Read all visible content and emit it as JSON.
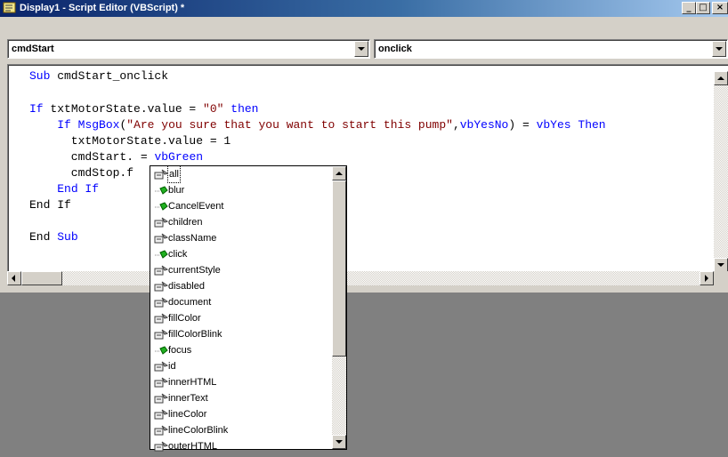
{
  "window": {
    "title": "Display1 - Script Editor (VBScript) *",
    "minimize_glyph": "_",
    "maximize_glyph": "□",
    "close_glyph": "×"
  },
  "combos": {
    "object": "cmdStart",
    "event": "onclick"
  },
  "code": {
    "lines": [
      [
        {
          "t": "Sub",
          "c": "kw"
        },
        {
          "t": " cmdStart_onclick",
          "c": ""
        }
      ],
      [],
      [
        {
          "t": "If",
          "c": "kw"
        },
        {
          "t": " txtMotorState.value = ",
          "c": ""
        },
        {
          "t": "\"0\"",
          "c": "str"
        },
        {
          "t": " ",
          "c": ""
        },
        {
          "t": "then",
          "c": "kw"
        }
      ],
      [
        {
          "t": "    ",
          "c": ""
        },
        {
          "t": "If",
          "c": "kw"
        },
        {
          "t": " ",
          "c": ""
        },
        {
          "t": "MsgBox",
          "c": "kw"
        },
        {
          "t": "(",
          "c": ""
        },
        {
          "t": "\"Are you sure that you want to start this pump\"",
          "c": "str"
        },
        {
          "t": ",",
          "c": ""
        },
        {
          "t": "vbYesNo",
          "c": "kw"
        },
        {
          "t": ") = ",
          "c": ""
        },
        {
          "t": "vbYes",
          "c": "kw"
        },
        {
          "t": " ",
          "c": ""
        },
        {
          "t": "Then",
          "c": "kw"
        }
      ],
      [
        {
          "t": "      txtMotorState.value = 1",
          "c": ""
        }
      ],
      [
        {
          "t": "      cmdStart. = ",
          "c": ""
        },
        {
          "t": "vbGreen",
          "c": "kw"
        }
      ],
      [
        {
          "t": "      cmdStop.f",
          "c": ""
        }
      ],
      [
        {
          "t": "    ",
          "c": ""
        },
        {
          "t": "End If",
          "c": "kw"
        }
      ],
      [
        {
          "t": "End If",
          "c": ""
        }
      ],
      [],
      [
        {
          "t": "End ",
          "c": ""
        },
        {
          "t": "Sub",
          "c": "kw"
        }
      ]
    ]
  },
  "autocomplete": {
    "selected": "all",
    "items": [
      {
        "label": "all",
        "kind": "property"
      },
      {
        "label": "blur",
        "kind": "method"
      },
      {
        "label": "CancelEvent",
        "kind": "method"
      },
      {
        "label": "children",
        "kind": "property"
      },
      {
        "label": "className",
        "kind": "property"
      },
      {
        "label": "click",
        "kind": "method"
      },
      {
        "label": "currentStyle",
        "kind": "property"
      },
      {
        "label": "disabled",
        "kind": "property"
      },
      {
        "label": "document",
        "kind": "property"
      },
      {
        "label": "fillColor",
        "kind": "property"
      },
      {
        "label": "fillColorBlink",
        "kind": "property"
      },
      {
        "label": "focus",
        "kind": "method"
      },
      {
        "label": "id",
        "kind": "property"
      },
      {
        "label": "innerHTML",
        "kind": "property"
      },
      {
        "label": "innerText",
        "kind": "property"
      },
      {
        "label": "lineColor",
        "kind": "property"
      },
      {
        "label": "lineColorBlink",
        "kind": "property"
      },
      {
        "label": "outerHTML",
        "kind": "property"
      }
    ]
  },
  "colors": {
    "keyword": "#0000ff",
    "string": "#800000",
    "title_start": "#0a246a",
    "title_end": "#a6caf0",
    "face": "#d4d0c8",
    "desktop": "#808080"
  }
}
